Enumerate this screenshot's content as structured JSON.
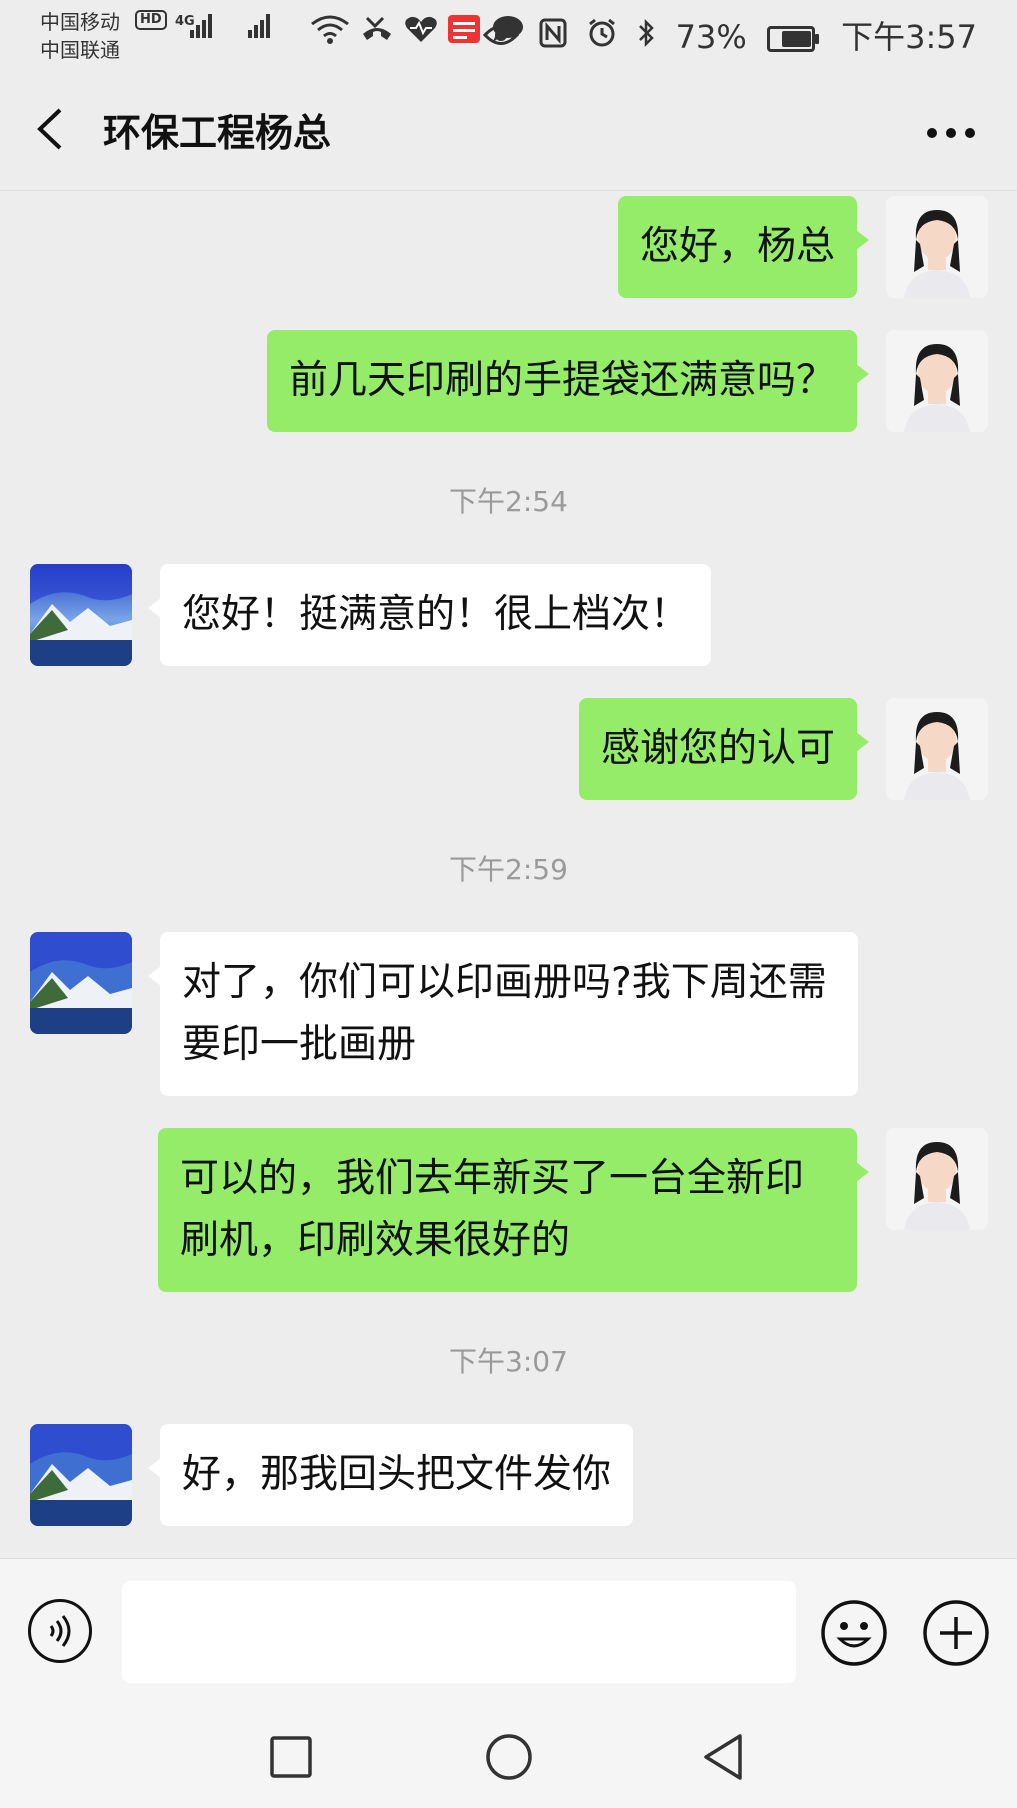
{
  "status_bar": {
    "carrier_1": "中国移动",
    "carrier_2": "中国联通",
    "hd_badge": "HD",
    "network": "4G",
    "battery_pct": "73%",
    "time": "下午3:57",
    "battery_level": 0.73
  },
  "header": {
    "title": "环保工程杨总"
  },
  "messages": [
    {
      "sender": "me",
      "text": "您好，杨总"
    },
    {
      "sender": "me",
      "text": "前几天印刷的手提袋还满意吗？"
    },
    {
      "time": "下午2:54"
    },
    {
      "sender": "them",
      "text": "您好！挺满意的！很上档次！"
    },
    {
      "sender": "me",
      "text": "感谢您的认可"
    },
    {
      "time": "下午2:59"
    },
    {
      "sender": "them",
      "text": "对了，你们可以印画册吗?我下周还需要印一批画册"
    },
    {
      "sender": "me",
      "text": "可以的，我们去年新买了一台全新印刷机，印刷效果很好的"
    },
    {
      "time": "下午3:07"
    },
    {
      "sender": "them",
      "text": "好，那我回头把文件发你"
    }
  ],
  "input": {
    "value": "",
    "placeholder": ""
  },
  "colors": {
    "my_bubble": "#95ec69",
    "their_bubble": "#ffffff",
    "background": "#ededed"
  },
  "icons": [
    "back-arrow-icon",
    "more-icon",
    "voice-icon",
    "emoji-icon",
    "plus-icon",
    "nav-square-icon",
    "nav-circle-icon",
    "nav-triangle-icon"
  ]
}
